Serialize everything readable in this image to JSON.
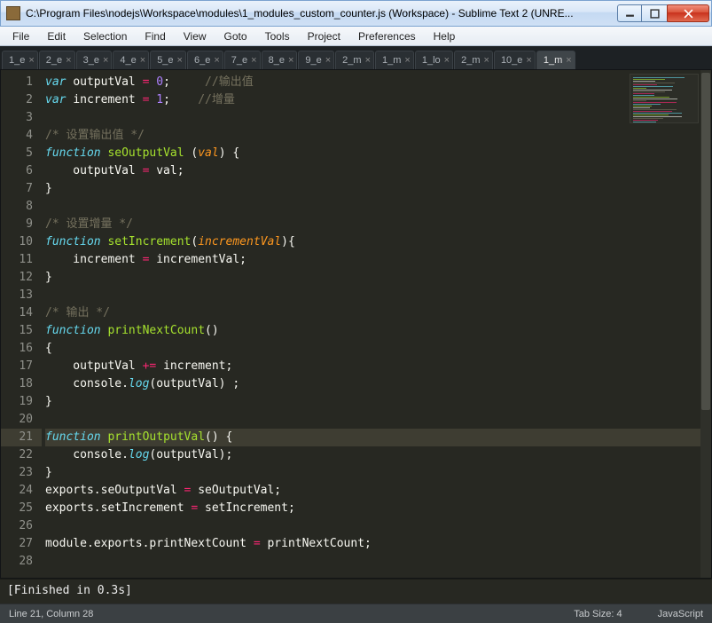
{
  "window": {
    "title": "C:\\Program Files\\nodejs\\Workspace\\modules\\1_modules_custom_counter.js (Workspace) - Sublime Text 2 (UNRE..."
  },
  "menu": [
    "File",
    "Edit",
    "Selection",
    "Find",
    "View",
    "Goto",
    "Tools",
    "Project",
    "Preferences",
    "Help"
  ],
  "tabs": [
    {
      "label": "1_e",
      "active": false
    },
    {
      "label": "2_e",
      "active": false
    },
    {
      "label": "3_e",
      "active": false
    },
    {
      "label": "4_e",
      "active": false
    },
    {
      "label": "5_e",
      "active": false
    },
    {
      "label": "6_e",
      "active": false
    },
    {
      "label": "7_e",
      "active": false
    },
    {
      "label": "8_e",
      "active": false
    },
    {
      "label": "9_e",
      "active": false
    },
    {
      "label": "2_m",
      "active": false
    },
    {
      "label": "1_m",
      "active": false
    },
    {
      "label": "1_lo",
      "active": false
    },
    {
      "label": "2_m",
      "active": false
    },
    {
      "label": "10_e",
      "active": false
    },
    {
      "label": "1_m",
      "active": true
    }
  ],
  "code": {
    "highlight_line": 21,
    "lines": [
      [
        {
          "t": "var ",
          "c": "kw"
        },
        {
          "t": "outputVal ",
          "c": "id"
        },
        {
          "t": "= ",
          "c": "op"
        },
        {
          "t": "0",
          "c": "nm"
        },
        {
          "t": ";     ",
          "c": "id"
        },
        {
          "t": "//输出值",
          "c": "cm"
        }
      ],
      [
        {
          "t": "var ",
          "c": "kw"
        },
        {
          "t": "increment ",
          "c": "id"
        },
        {
          "t": "= ",
          "c": "op"
        },
        {
          "t": "1",
          "c": "nm"
        },
        {
          "t": ";    ",
          "c": "id"
        },
        {
          "t": "//增量",
          "c": "cm"
        }
      ],
      [],
      [
        {
          "t": "/* 设置输出值 */",
          "c": "cm"
        }
      ],
      [
        {
          "t": "function ",
          "c": "kw"
        },
        {
          "t": "seOutputVal ",
          "c": "fn"
        },
        {
          "t": "(",
          "c": "id"
        },
        {
          "t": "val",
          "c": "pr"
        },
        {
          "t": ") {",
          "c": "id"
        }
      ],
      [
        {
          "t": "    outputVal ",
          "c": "id"
        },
        {
          "t": "= ",
          "c": "op"
        },
        {
          "t": "val;",
          "c": "id"
        }
      ],
      [
        {
          "t": "}",
          "c": "id"
        }
      ],
      [],
      [
        {
          "t": "/* 设置增量 */",
          "c": "cm"
        }
      ],
      [
        {
          "t": "function ",
          "c": "kw"
        },
        {
          "t": "setIncrement",
          "c": "fn"
        },
        {
          "t": "(",
          "c": "id"
        },
        {
          "t": "incrementVal",
          "c": "pr"
        },
        {
          "t": "){",
          "c": "id"
        }
      ],
      [
        {
          "t": "    increment ",
          "c": "id"
        },
        {
          "t": "= ",
          "c": "op"
        },
        {
          "t": "incrementVal;",
          "c": "id"
        }
      ],
      [
        {
          "t": "}",
          "c": "id"
        }
      ],
      [],
      [
        {
          "t": "/* 输出 */",
          "c": "cm"
        }
      ],
      [
        {
          "t": "function ",
          "c": "kw"
        },
        {
          "t": "printNextCount",
          "c": "fn"
        },
        {
          "t": "()",
          "c": "id"
        }
      ],
      [
        {
          "t": "{",
          "c": "id"
        }
      ],
      [
        {
          "t": "    outputVal ",
          "c": "id"
        },
        {
          "t": "+= ",
          "c": "op"
        },
        {
          "t": "increment;",
          "c": "id"
        }
      ],
      [
        {
          "t": "    console.",
          "c": "id"
        },
        {
          "t": "log",
          "c": "kw"
        },
        {
          "t": "(outputVal) ;",
          "c": "id"
        }
      ],
      [
        {
          "t": "}",
          "c": "id"
        }
      ],
      [],
      [
        {
          "t": "function ",
          "c": "kw"
        },
        {
          "t": "printOutputVal",
          "c": "fn"
        },
        {
          "t": "() {",
          "c": "id"
        }
      ],
      [
        {
          "t": "    console.",
          "c": "id"
        },
        {
          "t": "log",
          "c": "kw"
        },
        {
          "t": "(outputVal);",
          "c": "id"
        }
      ],
      [
        {
          "t": "}",
          "c": "id"
        }
      ],
      [
        {
          "t": "exports.seOutputVal ",
          "c": "id"
        },
        {
          "t": "= ",
          "c": "op"
        },
        {
          "t": "seOutputVal;",
          "c": "id"
        }
      ],
      [
        {
          "t": "exports.setIncrement ",
          "c": "id"
        },
        {
          "t": "= ",
          "c": "op"
        },
        {
          "t": "setIncrement;",
          "c": "id"
        }
      ],
      [],
      [
        {
          "t": "module.exports.printNextCount ",
          "c": "id"
        },
        {
          "t": "= ",
          "c": "op"
        },
        {
          "t": "printNextCount;",
          "c": "id"
        }
      ],
      []
    ]
  },
  "output": "[Finished in 0.3s]",
  "status": {
    "left": "Line 21, Column 28",
    "tab_size": "Tab Size: 4",
    "syntax": "JavaScript"
  }
}
